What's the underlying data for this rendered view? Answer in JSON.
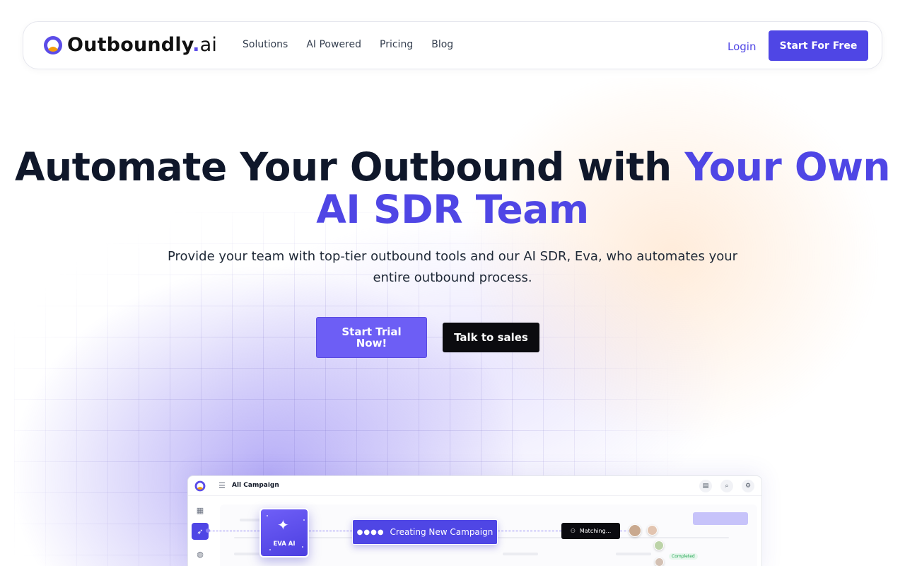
{
  "nav": {
    "brand_name": "Outboundly",
    "brand_dot": ".",
    "brand_suffix": "ai",
    "links": [
      {
        "label": "Solutions"
      },
      {
        "label": "AI Powered"
      },
      {
        "label": "Pricing"
      },
      {
        "label": "Blog"
      }
    ],
    "login_label": "Login",
    "cta_label": "Start For Free"
  },
  "hero": {
    "title_part1": "Automate Your Outbound with ",
    "title_accent": "Your Own AI SDR Team",
    "subtitle": "Provide your team with top-tier outbound tools and our AI SDR, Eva, who automates your entire outbound process.",
    "primary_button": "Start Trial Now!",
    "secondary_button": "Talk to sales"
  },
  "app_preview": {
    "title": "All Campaign",
    "eva_label": "EVA AI",
    "creating_label": "Creating New Campaign",
    "matching_label": "Matching...",
    "status_badge": "Completed"
  },
  "colors": {
    "accent": "#4f46e5",
    "primary_button": "#6d5ef5",
    "dark_button": "#0b0b0f"
  },
  "icons": {
    "logo": "outboundly-logo-icon",
    "eva": "sparkle-icon",
    "matching": "users-icon"
  }
}
